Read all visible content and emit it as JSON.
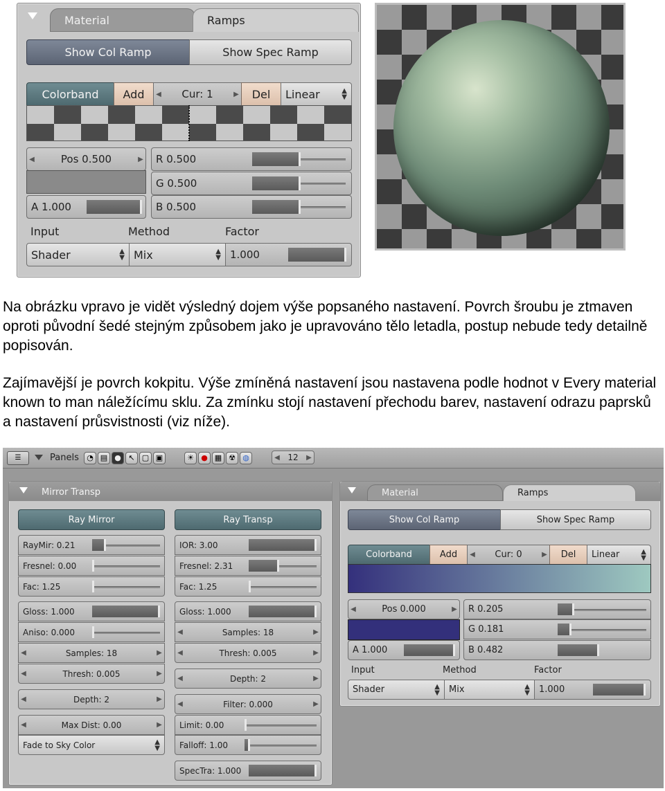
{
  "top_panel": {
    "tabs": [
      "Material",
      "Ramps"
    ],
    "show_col_ramp": "Show Col Ramp",
    "show_spec_ramp": "Show Spec Ramp",
    "colorband": "Colorband",
    "add": "Add",
    "cur": "Cur: 1",
    "del": "Del",
    "interp": "Linear",
    "pos": "Pos 0.500",
    "r": "R 0.500",
    "g": "G 0.500",
    "b": "B 0.500",
    "a": "A 1.000",
    "input_label": "Input",
    "method_label": "Method",
    "factor_label": "Factor",
    "input_value": "Shader",
    "method_value": "Mix",
    "factor_value": "1.000",
    "swatch_color": "#8a8a8a"
  },
  "text": {
    "p1": "Na obrázku vpravo je vidět výsledný dojem výše popsaného nastavení. Povrch šroubu je ztmaven oproti původní šedé stejným způsobem jako je upravováno tělo letadla, postup nebude tedy detailně popisován.",
    "p2": "Zajímavější je povrch kokpitu. Výše zmíněná nastavení jsou nastavena podle hodnot v Every material known to man náležícímu sklu. Za zmínku stojí nastavení přechodu barev, nastavení odrazu paprsků a nastavení průsvistnosti (viz níže)."
  },
  "toolbar": {
    "panels": "Panels",
    "page_num": "12"
  },
  "mirror_panel": {
    "title": "Mirror Transp",
    "ray_mirror": "Ray Mirror",
    "ray_transp": "Ray Transp",
    "raymir": "RayMir: 0.21",
    "fresnel_l": "Fresnel: 0.00",
    "fac_l": "Fac: 1.25",
    "gloss_l": "Gloss: 1.000",
    "aniso": "Aniso: 0.000",
    "samples_l": "Samples: 18",
    "thresh_l": "Thresh: 0.005",
    "depth_l": "Depth: 2",
    "maxdist": "Max Dist: 0.00",
    "fade": "Fade to Sky Color",
    "ior": "IOR: 3.00",
    "fresnel_r": "Fresnel: 2.31",
    "fac_r": "Fac: 1.25",
    "gloss_r": "Gloss: 1.000",
    "samples_r": "Samples: 18",
    "thresh_r": "Thresh: 0.005",
    "depth_r": "Depth: 2",
    "filter": "Filter: 0.000",
    "limit": "Limit: 0.00",
    "falloff": "Falloff: 1.00",
    "spectra": "SpecTra: 1.000"
  },
  "ramps2": {
    "tabs": [
      "Material",
      "Ramps"
    ],
    "show_col_ramp": "Show Col Ramp",
    "show_spec_ramp": "Show Spec Ramp",
    "colorband": "Colorband",
    "add": "Add",
    "cur": "Cur: 0",
    "del": "Del",
    "interp": "Linear",
    "pos": "Pos 0.000",
    "r": "R 0.205",
    "g": "G 0.181",
    "b": "B 0.482",
    "a": "A 1.000",
    "input_label": "Input",
    "method_label": "Method",
    "factor_label": "Factor",
    "input_value": "Shader",
    "method_value": "Mix",
    "factor_value": "1.000",
    "swatch_color": "#33307b",
    "band_start": "#34307c",
    "band_end": "#9ec9c0"
  }
}
